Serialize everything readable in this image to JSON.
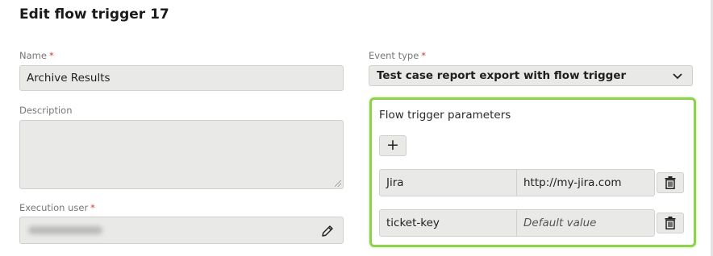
{
  "page": {
    "title": "Edit flow trigger 17"
  },
  "form": {
    "name": {
      "label": "Name",
      "required_mark": "*",
      "value": "Archive Results"
    },
    "description": {
      "label": "Description",
      "value": ""
    },
    "execution_user": {
      "label": "Execution user",
      "required_mark": "*"
    },
    "event_type": {
      "label": "Event type",
      "required_mark": "*",
      "value": "Test case report export with flow trigger"
    }
  },
  "parameters": {
    "title": "Flow trigger parameters",
    "add_label": "+",
    "rows": [
      {
        "key": "Jira",
        "value": "http://my-jira.com"
      },
      {
        "key": "ticket-key",
        "placeholder": "Default value"
      }
    ]
  },
  "colors": {
    "highlight": "#8fd14f",
    "required": "#d23b3b",
    "field_bg": "#e9eae8"
  },
  "icons": [
    "edit-pencil-icon",
    "chevron-down-icon",
    "trash-icon",
    "plus-icon"
  ]
}
